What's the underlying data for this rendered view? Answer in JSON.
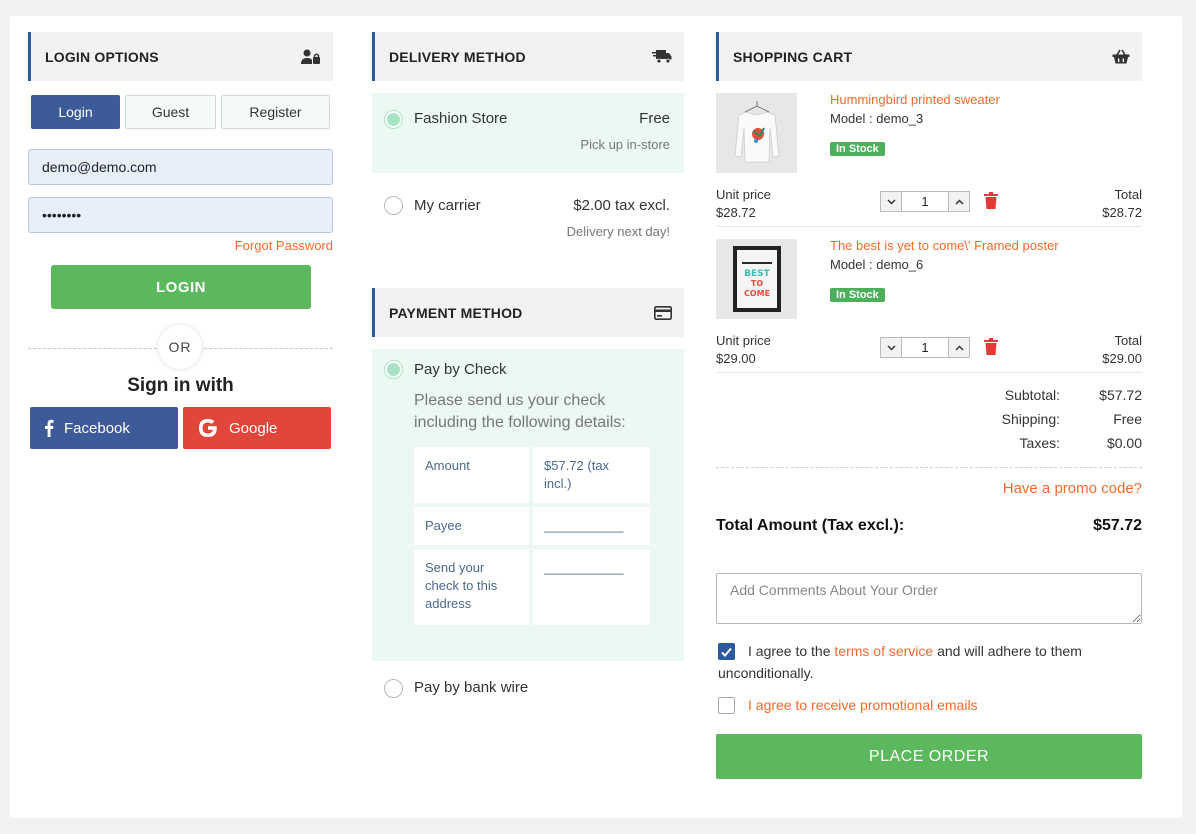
{
  "login": {
    "title": "LOGIN OPTIONS",
    "tabs": [
      {
        "label": "Login",
        "active": true
      },
      {
        "label": "Guest",
        "active": false
      },
      {
        "label": "Register",
        "active": false
      }
    ],
    "email_value": "demo@demo.com",
    "password_value": "demodemo",
    "forgot_label": "Forgot Password",
    "login_button": "LOGIN",
    "or_label": "OR",
    "sign_in_with": "Sign in with",
    "facebook_label": "Facebook",
    "google_label": "Google"
  },
  "delivery": {
    "title": "DELIVERY METHOD",
    "options": [
      {
        "name": "Fashion Store",
        "price": "Free",
        "note": "Pick up in-store",
        "selected": true
      },
      {
        "name": "My carrier",
        "price": "$2.00 tax excl.",
        "note": "Delivery next day!",
        "selected": false
      }
    ]
  },
  "payment": {
    "title": "PAYMENT METHOD",
    "check": {
      "label": "Pay by Check",
      "selected": true,
      "description": "Please send us your check including the following details:",
      "rows": [
        {
          "key": "Amount",
          "value": "$57.72 (tax incl.)"
        },
        {
          "key": "Payee",
          "value": "___________"
        },
        {
          "key": "Send your check to this address",
          "value": "___________"
        }
      ]
    },
    "wire": {
      "label": "Pay by bank wire",
      "selected": false
    }
  },
  "cart": {
    "title": "SHOPPING CART",
    "unit_price_label": "Unit price",
    "total_label": "Total",
    "items": [
      {
        "name": "Hummingbird printed sweater",
        "model": "Model : demo_3",
        "stock": "In Stock",
        "unit_price": "$28.72",
        "qty": "1",
        "total": "$28.72"
      },
      {
        "name": "The best is yet to come\\' Framed poster",
        "model": "Model : demo_6",
        "stock": "In Stock",
        "unit_price": "$29.00",
        "qty": "1",
        "total": "$29.00"
      }
    ],
    "subtotal_label": "Subtotal:",
    "subtotal": "$57.72",
    "shipping_label": "Shipping:",
    "shipping": "Free",
    "taxes_label": "Taxes:",
    "taxes": "$0.00",
    "promo_label": "Have a promo code?",
    "total_amount_label": "Total Amount (Tax excl.):",
    "total_amount": "$57.72",
    "comments_placeholder": "Add Comments About Your Order",
    "terms_prefix": "I agree to the",
    "terms_link": "terms of service",
    "terms_suffix": "and will adhere to them",
    "terms_line2": "unconditionally.",
    "terms_checked": true,
    "promo_emails_label": "I agree to receive promotional emails",
    "promo_emails_checked": false,
    "place_order": "PLACE ORDER"
  },
  "poster_text": [
    "BEST",
    "TO",
    "COME"
  ],
  "colors": {
    "accent_blue": "#3d5a99",
    "green": "#5cb85c",
    "orange": "#f26b2b",
    "facebook": "#3d5a99",
    "google": "#e0473a"
  }
}
